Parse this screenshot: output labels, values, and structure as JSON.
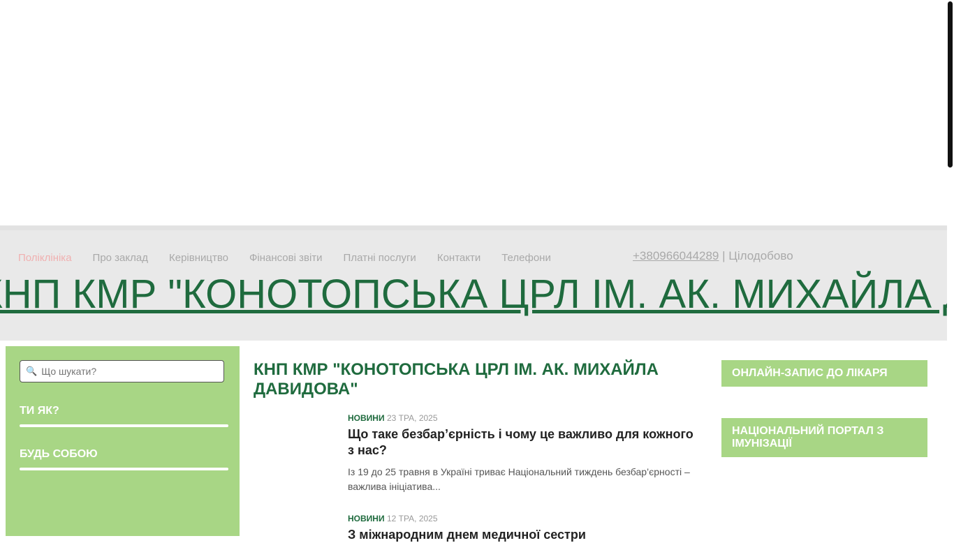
{
  "nav": {
    "items": [
      "Поліклініка",
      "Про заклад",
      "Керівництво",
      "Фінансові звіти",
      "Платні послуги",
      "Контакти",
      "Телефони"
    ],
    "active": "Поліклініка"
  },
  "contact": {
    "phone": "+380966044289",
    "separator": " | ",
    "hours": "Цілодобово"
  },
  "site_title": "КНП КМР \"КОНОТОПСЬКА ЦРЛ ІМ. АК. МИХАЙЛА ДАВИДОВА\"",
  "sidebar": {
    "search_placeholder": "Що шукати?",
    "search_icon": "magnifier-icon",
    "headings": [
      "ТИ ЯК?",
      "БУДЬ СОБОЮ"
    ]
  },
  "main": {
    "title": "КНП КМР \"КОНОТОПСЬКА ЦРЛ ІМ. АК. МИХАЙЛА ДАВИДОВА\"",
    "posts": [
      {
        "category": "НОВИНИ",
        "date": "23 ТРА, 2025",
        "title": "Що таке безбар’єрність і чому це важливо для кожного з нас?",
        "excerpt": "Із 19 до 25 травня в Україні триває Національний тиждень безбар’єрності – важлива ініціатива..."
      },
      {
        "category": "НОВИНИ",
        "date": "12 ТРА, 2025",
        "title": "З міжнародним днем медичної сестри",
        "excerpt": ""
      }
    ]
  },
  "right": {
    "boxes": [
      "ОНЛАЙН-ЗАПИС ДО ЛІКАРЯ",
      "НАЦІОНАЛЬНИЙ ПОРТАЛ З ІМУНІЗАЦІЇ"
    ]
  },
  "colors": {
    "green_dark": "#1f6b3e",
    "green_light": "#a8d685",
    "header_bg": "#e9e9e9"
  }
}
